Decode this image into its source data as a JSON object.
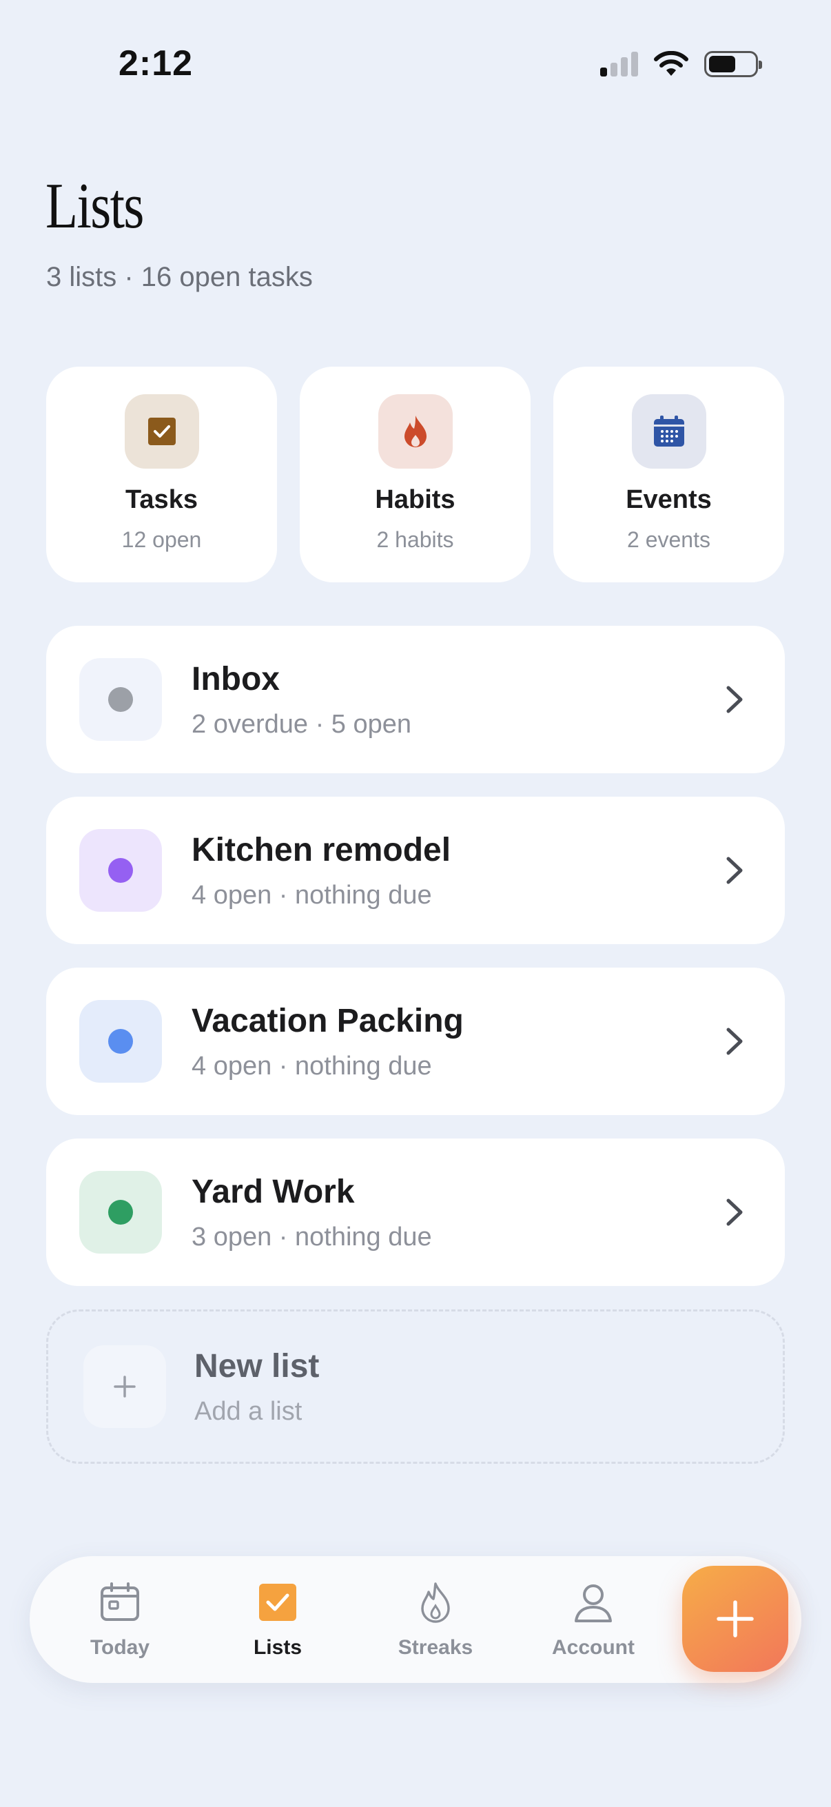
{
  "status_bar": {
    "time": "2:12"
  },
  "header": {
    "title": "Lists",
    "subtitle": "3 lists · 16 open tasks"
  },
  "categories": [
    {
      "label": "Tasks",
      "sub": "12 open",
      "icon": "checkbox-icon",
      "bg": "#ece3d8",
      "color": "#8b5a1c"
    },
    {
      "label": "Habits",
      "sub": "2 habits",
      "icon": "flame-icon",
      "bg": "#f4e1dc",
      "color": "#cc4b2b"
    },
    {
      "label": "Events",
      "sub": "2 events",
      "icon": "calendar-icon",
      "bg": "#e3e6f0",
      "color": "#2f55a6"
    }
  ],
  "lists": [
    {
      "name": "Inbox",
      "meta": "2 overdue · 5 open",
      "dot": "#9ca0a7",
      "tint": "#f0f3fb"
    },
    {
      "name": "Kitchen remodel",
      "meta": "4 open · nothing due",
      "dot": "#9560f2",
      "tint": "#ede5fd"
    },
    {
      "name": "Vacation Packing",
      "meta": "4 open · nothing due",
      "dot": "#5a8ef0",
      "tint": "#e4ecfb"
    },
    {
      "name": "Yard Work",
      "meta": "3 open · nothing due",
      "dot": "#2e9e62",
      "tint": "#e0f1e7"
    }
  ],
  "new_list": {
    "title": "New list",
    "sub": "Add a list"
  },
  "tabbar": {
    "tabs": [
      {
        "label": "Today",
        "icon": "calendar-day-icon",
        "active": false
      },
      {
        "label": "Lists",
        "icon": "lists-checkbox-icon",
        "active": true
      },
      {
        "label": "Streaks",
        "icon": "flame-outline-icon",
        "active": false
      },
      {
        "label": "Account",
        "icon": "person-icon",
        "active": false
      }
    ],
    "fab_icon": "plus-icon"
  },
  "colors": {
    "background": "#ebf0f9",
    "accent": "#f5a23f"
  }
}
